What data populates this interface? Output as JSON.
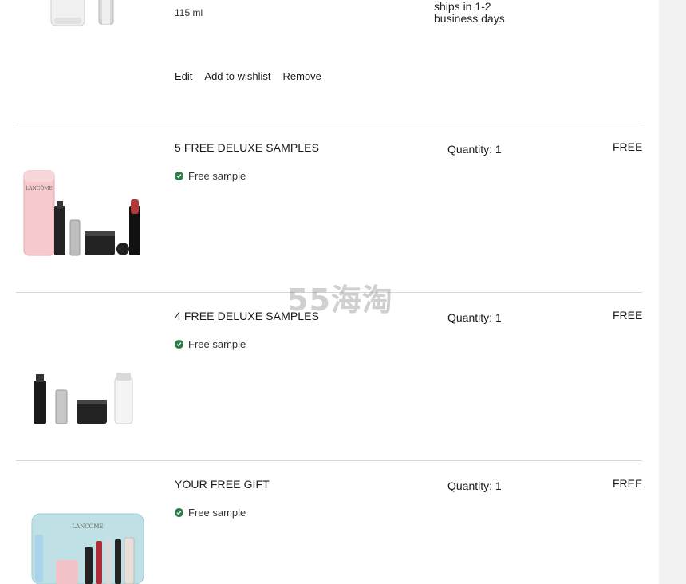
{
  "first_item": {
    "size": "115 ml",
    "shipping_note": "ships in 1-2 business days",
    "actions": {
      "edit": "Edit",
      "wishlist": "Add to wishlist",
      "remove": "Remove"
    }
  },
  "items": [
    {
      "name": "5 FREE DELUXE SAMPLES",
      "status": "Free sample",
      "quantity": "Quantity: 1",
      "price": "FREE"
    },
    {
      "name": "4 FREE DELUXE SAMPLES",
      "status": "Free sample",
      "quantity": "Quantity: 1",
      "price": "FREE"
    },
    {
      "name": "YOUR FREE GIFT",
      "status": "Free sample",
      "quantity": "Quantity: 1",
      "price": "FREE"
    }
  ],
  "watermark": "55海淘",
  "colors": {
    "check": "#2f7d46",
    "divider": "#d8d8d8",
    "gutter": "#f2f2f2"
  }
}
